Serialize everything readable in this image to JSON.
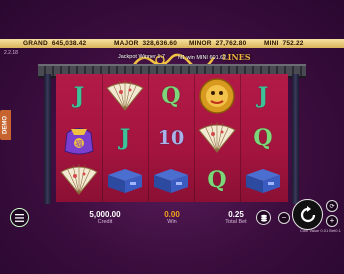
{
  "jackpots": [
    {
      "label": "GRAND",
      "value": "645,038.42"
    },
    {
      "label": "MAJOR",
      "value": "328,636.60"
    },
    {
      "label": "MINOR",
      "value": "27,762.80"
    },
    {
      "label": "MINI",
      "value": "752.22"
    }
  ],
  "version": "2.2.18",
  "banner": {
    "message": "Jackpot Winner 1.7",
    "win_text": "N1 win MINI 601.62",
    "logo_tail": "LINES"
  },
  "demo_label": "DEMO",
  "reels": [
    [
      "J",
      "fortune-bag",
      "fan"
    ],
    [
      "fan",
      "J",
      "chest"
    ],
    [
      "Q",
      "10",
      "chest"
    ],
    [
      "gold-lion",
      "fan",
      "Q"
    ],
    [
      "J",
      "Q",
      "chest"
    ]
  ],
  "controls": {
    "credit_value": "5,000.00",
    "credit_label": "Credit",
    "win_value": "0.00",
    "win_label": "Win",
    "bet_value": "0.25",
    "bet_label": "Total Bet",
    "coin_value_text": "Coin Value 0.01 Bet0.1"
  },
  "colors": {
    "win_accent": "#f3a21a",
    "jackpot_bar": "#f0d58a",
    "reel_bg": "#b31a47"
  }
}
